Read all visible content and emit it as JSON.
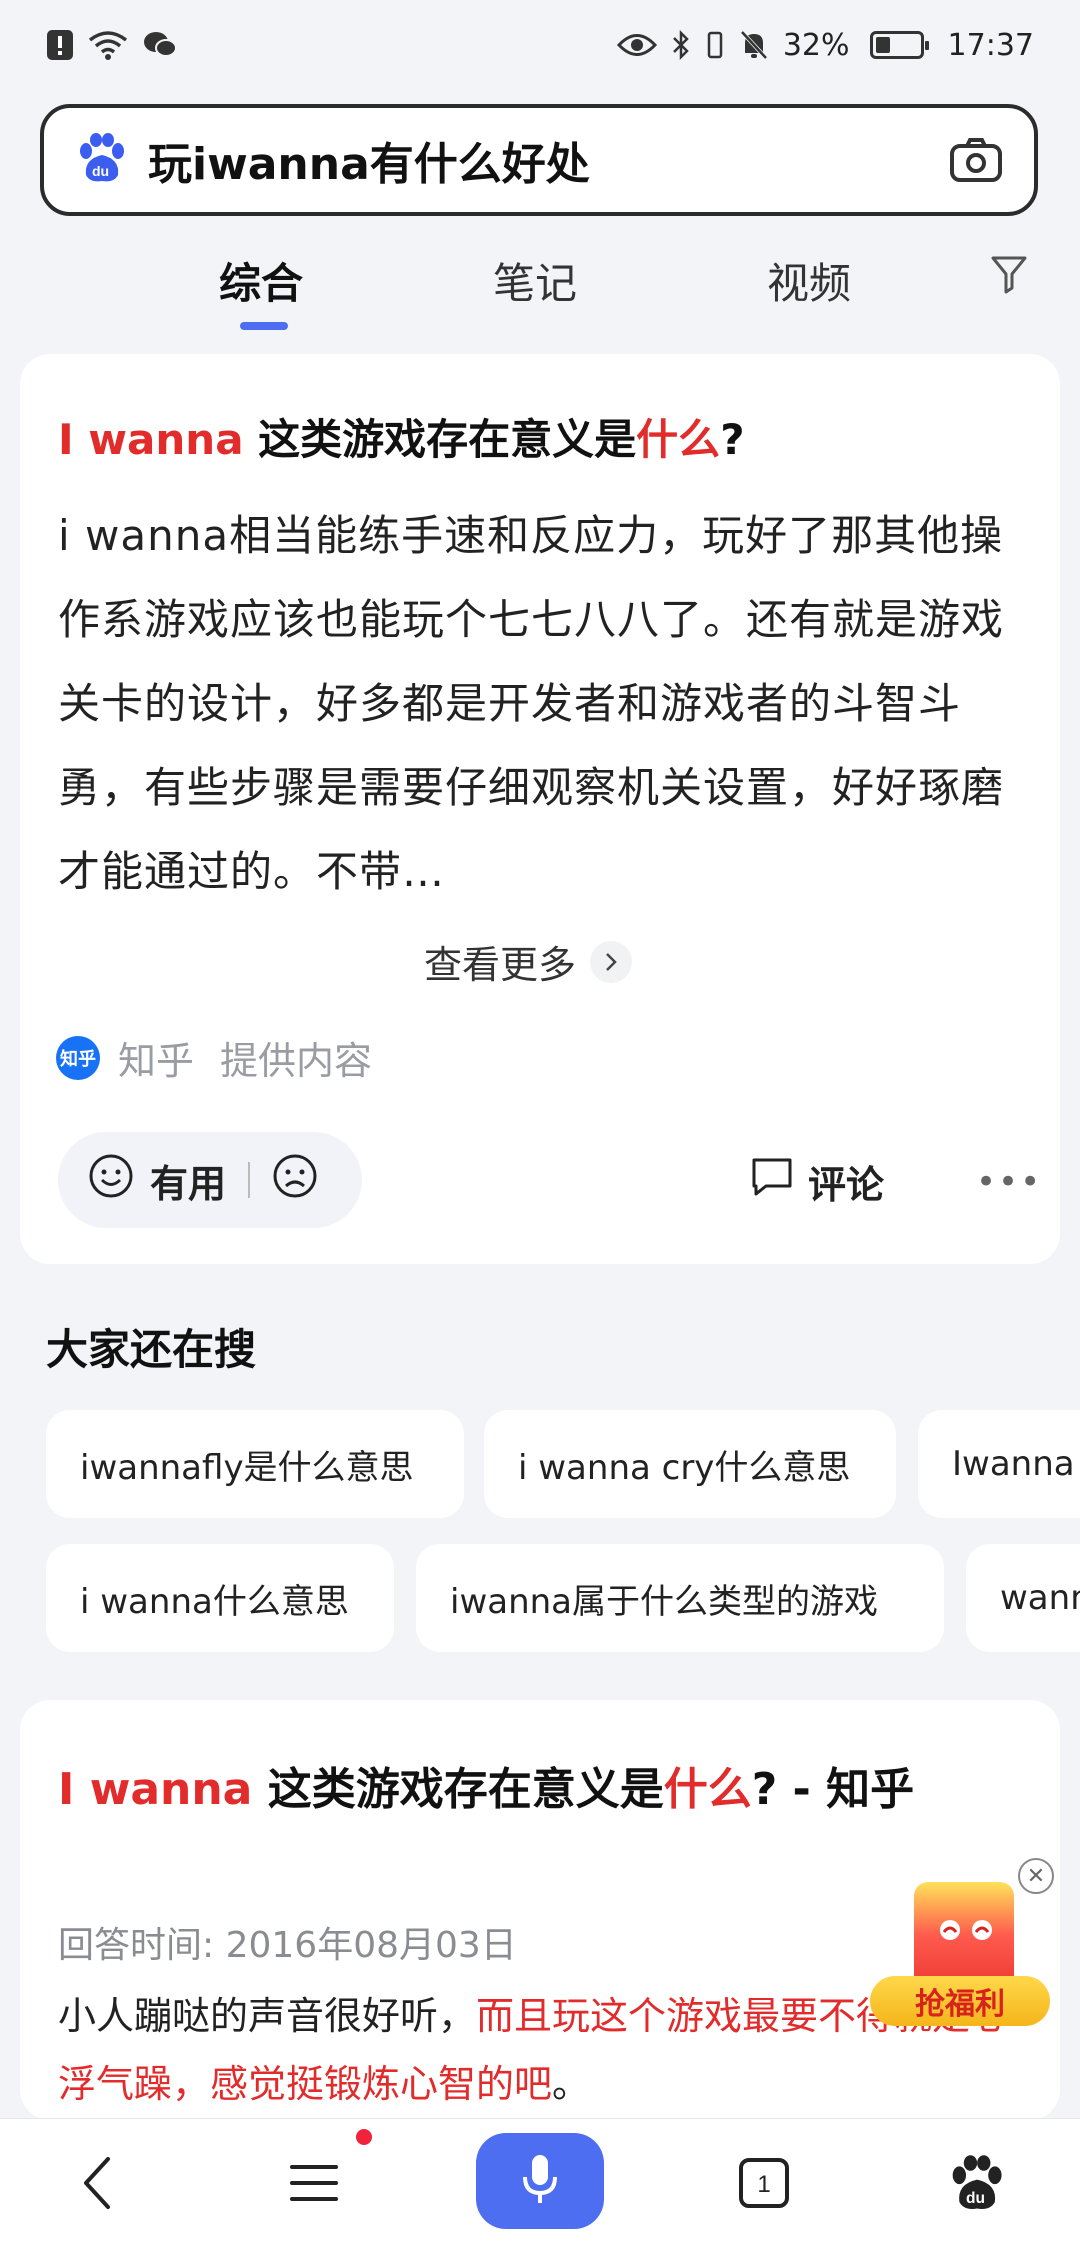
{
  "status_bar": {
    "battery": "32%",
    "time": "17:37"
  },
  "search": {
    "query": "玩iwanna有什么好处"
  },
  "tabs": [
    {
      "label": "综合"
    },
    {
      "label": "笔记"
    },
    {
      "label": "视频"
    }
  ],
  "card1": {
    "title_red": "I wanna",
    "title_black": " 这类游戏存在意义是",
    "title_red2": "什么",
    "title_end": "?",
    "body": "i wanna相当能练手速和反应力，玩好了那其他操作系游戏应该也能玩个七七八八了。还有就是游戏关卡的设计，好多都是开发者和游戏者的斗智斗勇，有些步骤是需要仔细观察机关设置，好好琢磨才能通过的。不带…",
    "more": "查看更多",
    "source_logo": "知乎",
    "source_name": "知乎",
    "source_suffix": "提供内容",
    "useful": "有用",
    "comment": "评论"
  },
  "related": {
    "title": "大家还在搜",
    "chips_row1": [
      "iwannafly是什么意思",
      "i wanna cry什么意思",
      "Iwanna"
    ],
    "chips_row2": [
      "i wanna什么意思",
      "iwanna属于什么类型的游戏",
      "wann"
    ]
  },
  "card2": {
    "title_red": "I wanna",
    "title_black": " 这类游戏存在意义是",
    "title_red2": "什么",
    "title_end": "? - 知乎",
    "time": "回答时间: 2016年08月03日",
    "body_black": "小人蹦哒的声音很好听，",
    "body_red": "而且玩这个游戏最要不得就是心浮气躁，感觉挺锻炼心智的吧",
    "body_end": "。"
  },
  "promo": {
    "label": "抢福利"
  },
  "bottom_nav": {
    "tab_count": "1"
  }
}
